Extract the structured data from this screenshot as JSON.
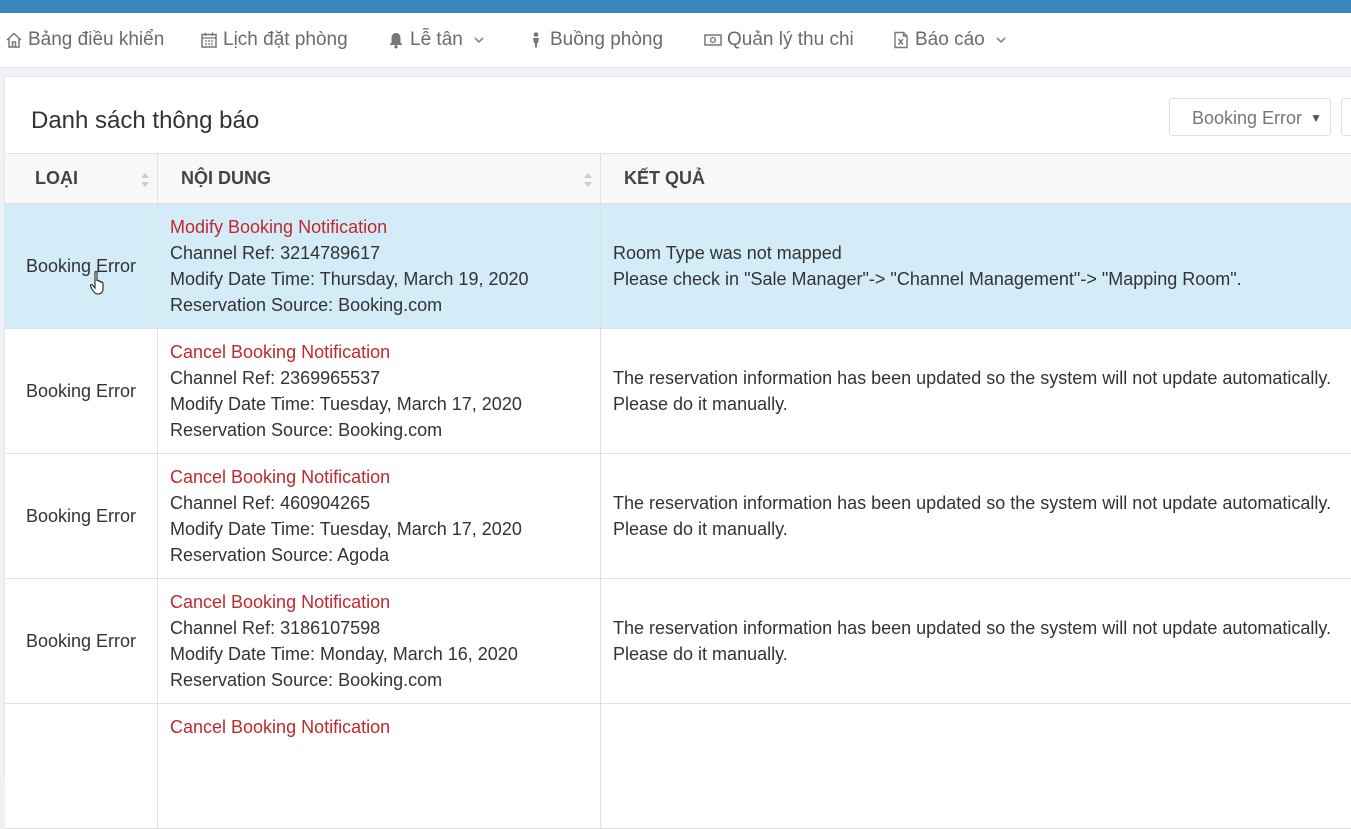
{
  "nav": {
    "items": [
      {
        "label": "Bảng điều khiển",
        "icon": "home-icon"
      },
      {
        "label": "Lịch đặt phòng",
        "icon": "calendar-icon"
      },
      {
        "label": "Lễ tân",
        "icon": "bell-icon",
        "dropdown": true
      },
      {
        "label": "Buồng phòng",
        "icon": "person-icon"
      },
      {
        "label": "Quản lý thu chi",
        "icon": "money-icon"
      },
      {
        "label": "Báo cáo",
        "icon": "excel-file-icon",
        "dropdown": true
      }
    ]
  },
  "panel": {
    "title": "Danh sách thông báo",
    "filter": {
      "selected": "Booking Error"
    }
  },
  "table": {
    "columns": [
      "LOẠI",
      "NỘI DUNG",
      "KẾT QUẢ"
    ],
    "rows": [
      {
        "type": "Booking Error",
        "title": "Modify Booking Notification",
        "channel_ref": "Channel Ref: 3214789617",
        "modify_date": "Modify Date Time: Thursday, March 19, 2020",
        "source": "Reservation Source: Booking.com",
        "result_1": "Room Type was not mapped",
        "result_2": "Please check in \"Sale Manager\"-> \"Channel Management\"-> \"Mapping Room\".",
        "selected": true
      },
      {
        "type": "Booking Error",
        "title": "Cancel Booking Notification",
        "channel_ref": "Channel Ref: 2369965537",
        "modify_date": "Modify Date Time: Tuesday, March 17, 2020",
        "source": "Reservation Source: Booking.com",
        "result_1": "The reservation information has been updated so the system will not update automatically.",
        "result_2": "Please do it manually."
      },
      {
        "type": "Booking Error",
        "title": "Cancel Booking Notification",
        "channel_ref": "Channel Ref: 460904265",
        "modify_date": "Modify Date Time: Tuesday, March 17, 2020",
        "source": "Reservation Source: Agoda",
        "result_1": "The reservation information has been updated so the system will not update automatically.",
        "result_2": "Please do it manually."
      },
      {
        "type": "Booking Error",
        "title": "Cancel Booking Notification",
        "channel_ref": "Channel Ref: 3186107598",
        "modify_date": "Modify Date Time: Monday, March 16, 2020",
        "source": "Reservation Source: Booking.com",
        "result_1": "The reservation information has been updated so the system will not update automatically.",
        "result_2": "Please do it manually."
      },
      {
        "type": "",
        "title": "Cancel Booking Notification",
        "channel_ref": "",
        "modify_date": "",
        "source": "",
        "result_1": "",
        "result_2": ""
      }
    ]
  },
  "colors": {
    "topbar": "#3a87c0",
    "notification_title": "#c0282d",
    "selected_row": "#d3ecf8"
  }
}
